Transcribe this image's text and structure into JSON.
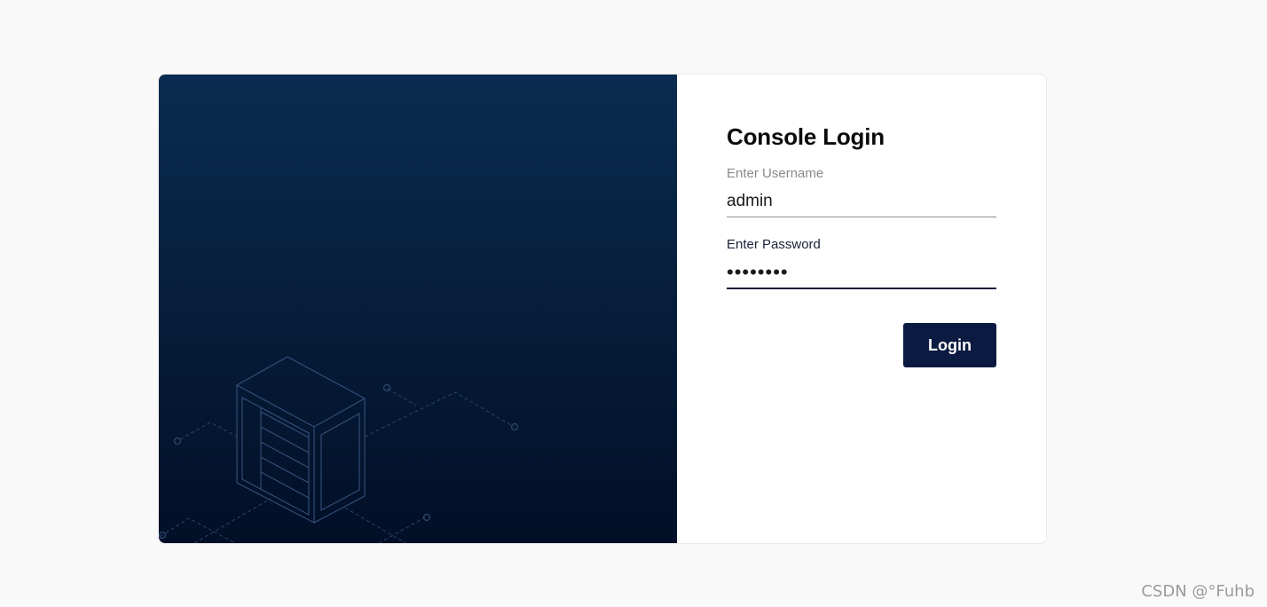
{
  "login": {
    "title": "Console Login",
    "username": {
      "label": "Enter Username",
      "value": "admin"
    },
    "password": {
      "label": "Enter Password",
      "value": "12345678"
    },
    "submit_label": "Login"
  },
  "watermark": "CSDN @°Fuhb",
  "colors": {
    "page_background": "#f9f9f9",
    "hero_gradient_top": "#0a2c50",
    "hero_gradient_bottom": "#020f27",
    "button_background": "#0b1a40",
    "active_field_underline": "#0f1a36"
  },
  "icons": {
    "hero_illustration": "server-rack-illustration-icon"
  }
}
